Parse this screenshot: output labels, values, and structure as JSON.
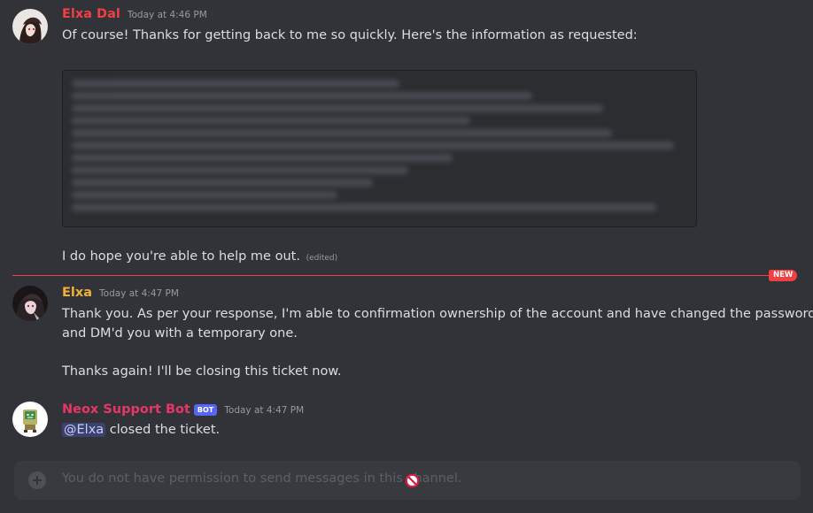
{
  "messages": [
    {
      "author": "Elxa Dal",
      "author_color": "#f23f43",
      "timestamp": "Today at 4:46 PM",
      "line1": "Of course! Thanks for getting back to me so quickly. Here's the information as requested:",
      "line2": "I do hope you're able to help me out.",
      "edited_label": "(edited)"
    },
    {
      "author": "Elxa",
      "author_color": "#f0b232",
      "timestamp": "Today at 4:47 PM",
      "line1": "Thank you. As per your response, I'm able to confirmation ownership of the account and have changed the password",
      "line2": "and DM'd you with a temporary one.",
      "line3": "Thanks again! I'll be closing this ticket now."
    },
    {
      "author": "Neox Support Bot",
      "author_color": "#e8356a",
      "bot_tag": "BOT",
      "timestamp": "Today at 4:47 PM",
      "mention": "@Elxa",
      "text": "closed the ticket."
    }
  ],
  "divider": {
    "badge": "NEW",
    "color": "#f23f43"
  },
  "composer": {
    "placeholder": "You do not have permission to send messages in this channel.",
    "plus_icon": "plus-circle-icon",
    "blocked_icon": "no-entry-icon"
  }
}
